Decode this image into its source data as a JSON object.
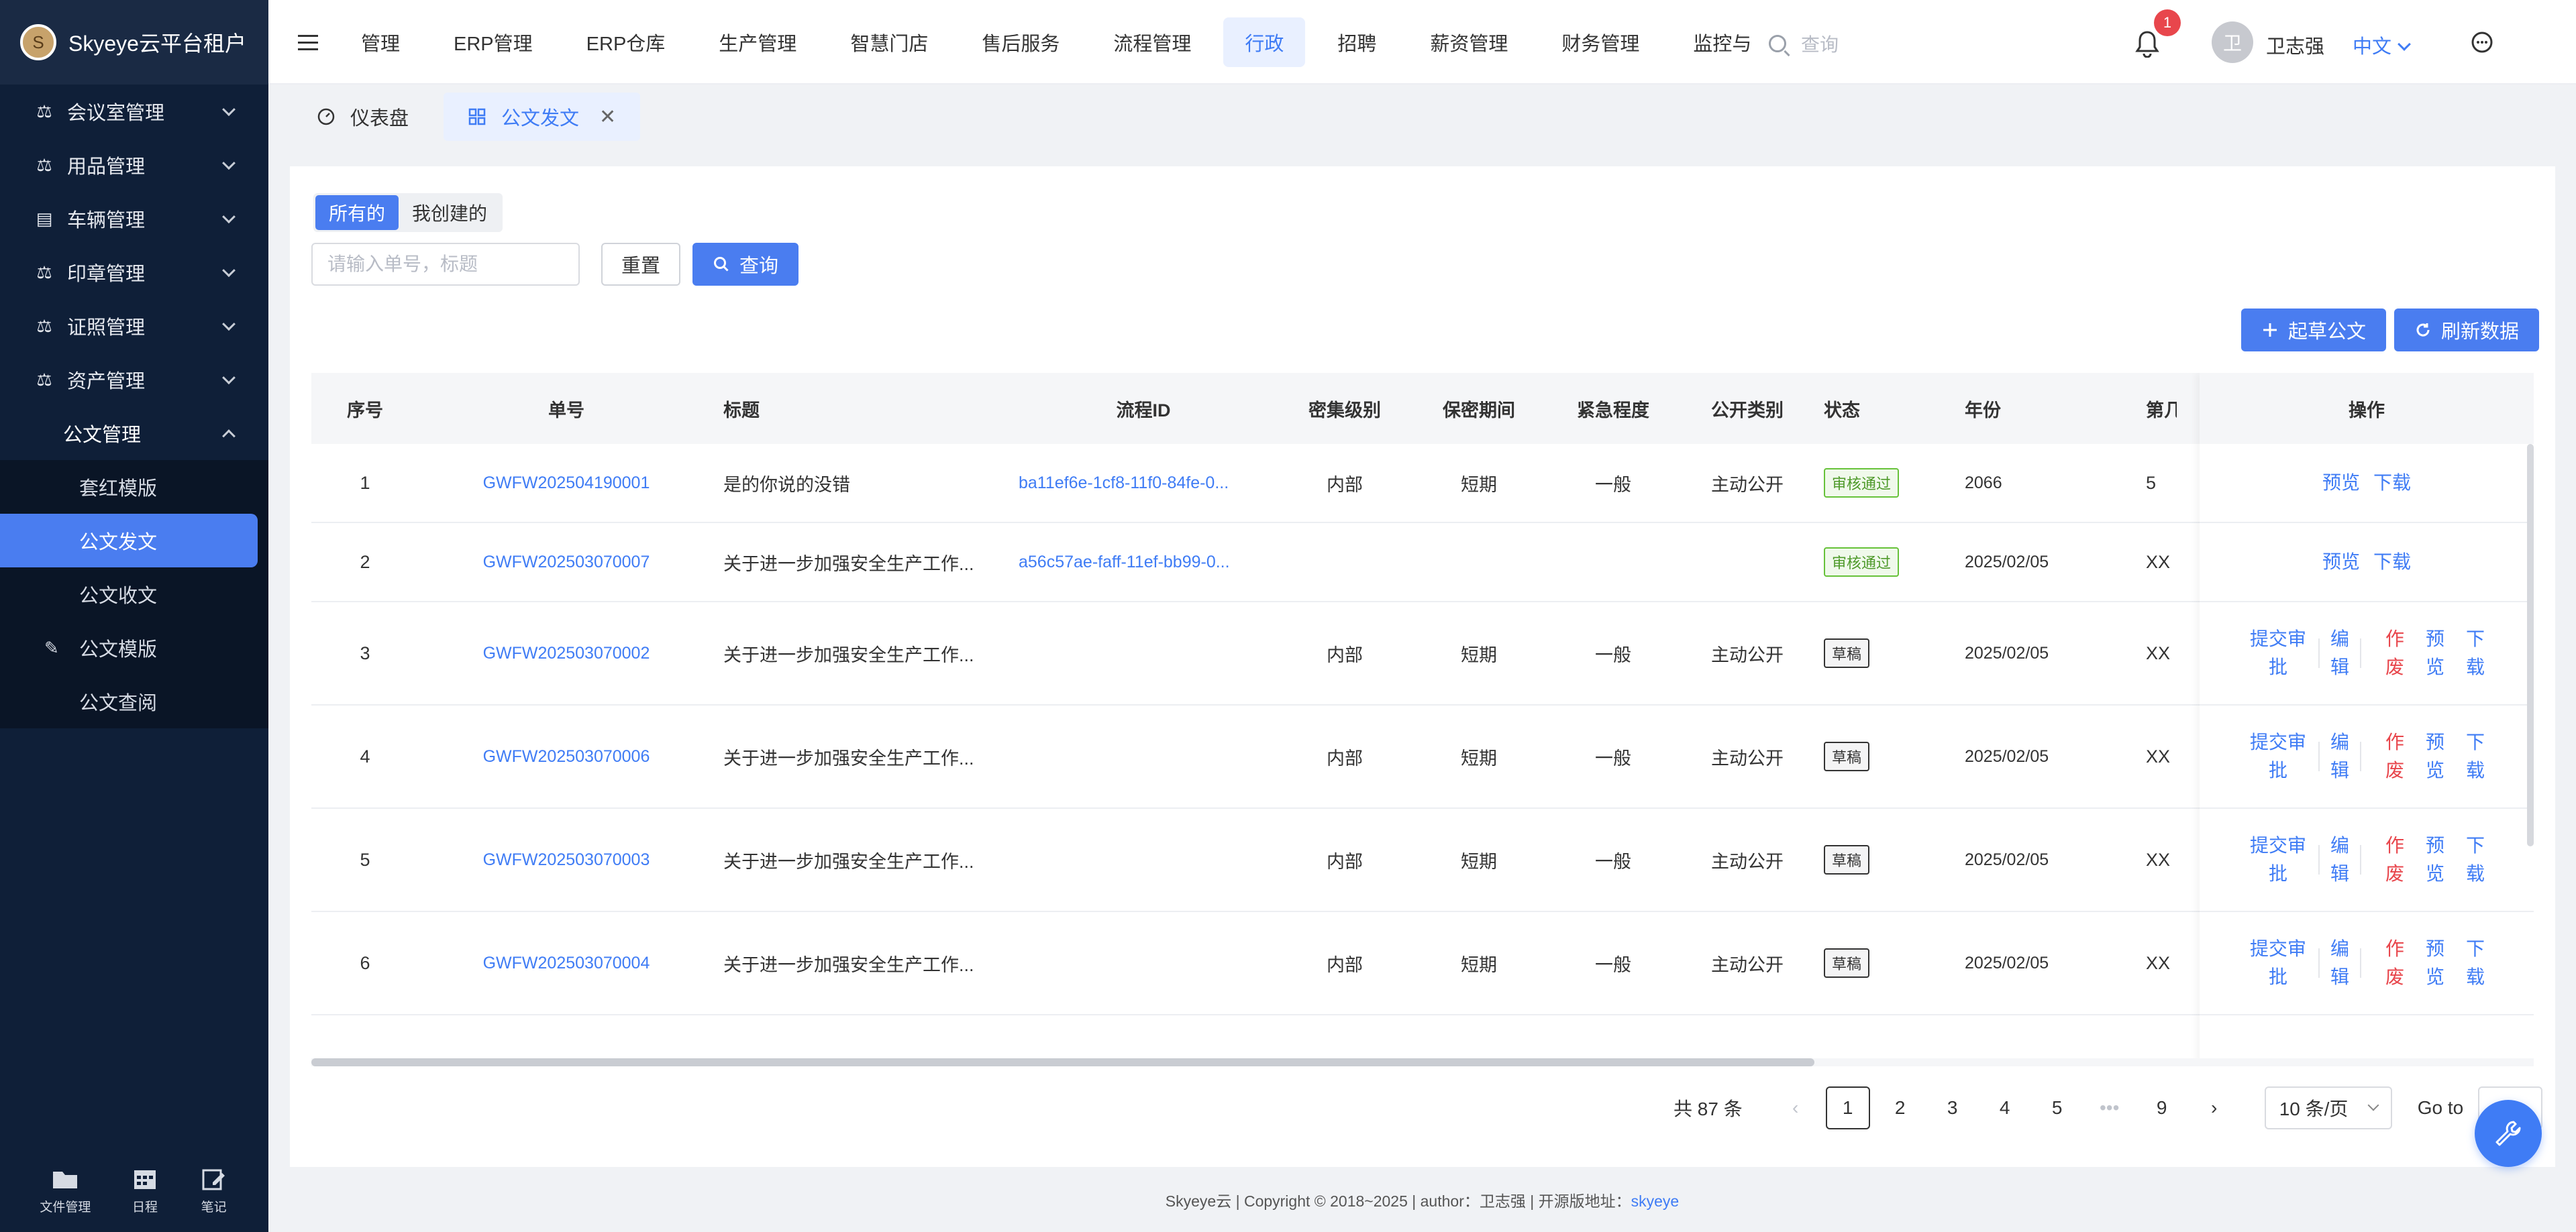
{
  "app": {
    "title": "Skyeye云平台租户",
    "logo_char": "S"
  },
  "sidebar": {
    "items": [
      {
        "label": "会议室管理",
        "icon": "scale-icon"
      },
      {
        "label": "用品管理",
        "icon": "scale-icon"
      },
      {
        "label": "车辆管理",
        "icon": "archive-icon"
      },
      {
        "label": "印章管理",
        "icon": "scale-icon"
      },
      {
        "label": "证照管理",
        "icon": "scale-icon"
      },
      {
        "label": "资产管理",
        "icon": "scale-icon"
      }
    ],
    "open_group": "公文管理",
    "sub_items": [
      "套红模版",
      "公文发文",
      "公文收文",
      "公文模版",
      "公文查阅"
    ],
    "active_sub": "公文发文",
    "bottom": [
      {
        "label": "文件管理",
        "icon": "folder-icon"
      },
      {
        "label": "日程",
        "icon": "calendar-icon"
      },
      {
        "label": "笔记",
        "icon": "edit-icon"
      }
    ]
  },
  "header": {
    "nav": [
      "管理",
      "ERP管理",
      "ERP仓库",
      "生产管理",
      "智慧门店",
      "售后服务",
      "流程管理",
      "行政",
      "招聘",
      "薪资管理",
      "财务管理",
      "监控与"
    ],
    "active_nav": "行政",
    "search_placeholder": "查询",
    "notification_count": "1",
    "avatar_char": "卫",
    "username": "卫志强",
    "language": "中文"
  },
  "tabs": [
    {
      "label": "仪表盘",
      "icon": "dashboard-icon"
    },
    {
      "label": "公文发文",
      "icon": "grid-icon"
    }
  ],
  "page": {
    "segments": [
      "所有的",
      "我创建的"
    ],
    "active_segment": "所有的",
    "search_placeholder": "请输入单号，标题",
    "reset_label": "重置",
    "query_label": "查询",
    "create_label": "起草公文",
    "refresh_label": "刷新数据"
  },
  "table": {
    "columns": [
      "序号",
      "单号",
      "标题",
      "流程ID",
      "密集级别",
      "保密期间",
      "紧急程度",
      "公开类别",
      "状态",
      "年份",
      "第几",
      "操作"
    ],
    "rows": [
      {
        "no": "1",
        "code": "GWFW202504190001",
        "title": "是的你说的没错",
        "flow": "ba11ef6e-1cf8-11f0-84fe-0...",
        "level": "内部",
        "period": "短期",
        "urgency": "一般",
        "public": "主动公开",
        "status": "审核通过",
        "status_type": "ok",
        "year": "2066",
        "nth": "5",
        "ops": "view"
      },
      {
        "no": "2",
        "code": "GWFW202503070007",
        "title": "关于进一步加强安全生产工作...",
        "flow": "a56c57ae-faff-11ef-bb99-0...",
        "level": "",
        "period": "",
        "urgency": "",
        "public": "",
        "status": "审核通过",
        "status_type": "ok",
        "year": "2025/02/05",
        "nth": "XX",
        "ops": "view"
      },
      {
        "no": "3",
        "code": "GWFW202503070002",
        "title": "关于进一步加强安全生产工作...",
        "flow": "",
        "level": "内部",
        "period": "短期",
        "urgency": "一般",
        "public": "主动公开",
        "status": "草稿",
        "status_type": "draft",
        "year": "2025/02/05",
        "nth": "XX",
        "ops": "full"
      },
      {
        "no": "4",
        "code": "GWFW202503070006",
        "title": "关于进一步加强安全生产工作...",
        "flow": "",
        "level": "内部",
        "period": "短期",
        "urgency": "一般",
        "public": "主动公开",
        "status": "草稿",
        "status_type": "draft",
        "year": "2025/02/05",
        "nth": "XX",
        "ops": "full"
      },
      {
        "no": "5",
        "code": "GWFW202503070003",
        "title": "关于进一步加强安全生产工作...",
        "flow": "",
        "level": "内部",
        "period": "短期",
        "urgency": "一般",
        "public": "主动公开",
        "status": "草稿",
        "status_type": "draft",
        "year": "2025/02/05",
        "nth": "XX",
        "ops": "full"
      },
      {
        "no": "6",
        "code": "GWFW202503070004",
        "title": "关于进一步加强安全生产工作...",
        "flow": "",
        "level": "内部",
        "period": "短期",
        "urgency": "一般",
        "public": "主动公开",
        "status": "草稿",
        "status_type": "draft",
        "year": "2025/02/05",
        "nth": "XX",
        "ops": "full"
      }
    ],
    "ops_labels": {
      "preview": "预览",
      "download": "下载",
      "submit": "提交审批",
      "edit": "编辑",
      "void": "作废"
    }
  },
  "pager": {
    "total": "共 87 条",
    "pages": [
      "1",
      "2",
      "3",
      "4",
      "5",
      "•••",
      "9"
    ],
    "active_page": "1",
    "size": "10 条/页",
    "goto": "Go to"
  },
  "footer": {
    "text": "Skyeye云 | Copyright © 2018~2025 | author：卫志强 | 开源版地址：",
    "link": "skyeye"
  },
  "colors": {
    "primary": "#4a7df0",
    "sidebar": "#0f1f38",
    "danger": "#e8464c",
    "success": "#67c23a"
  }
}
